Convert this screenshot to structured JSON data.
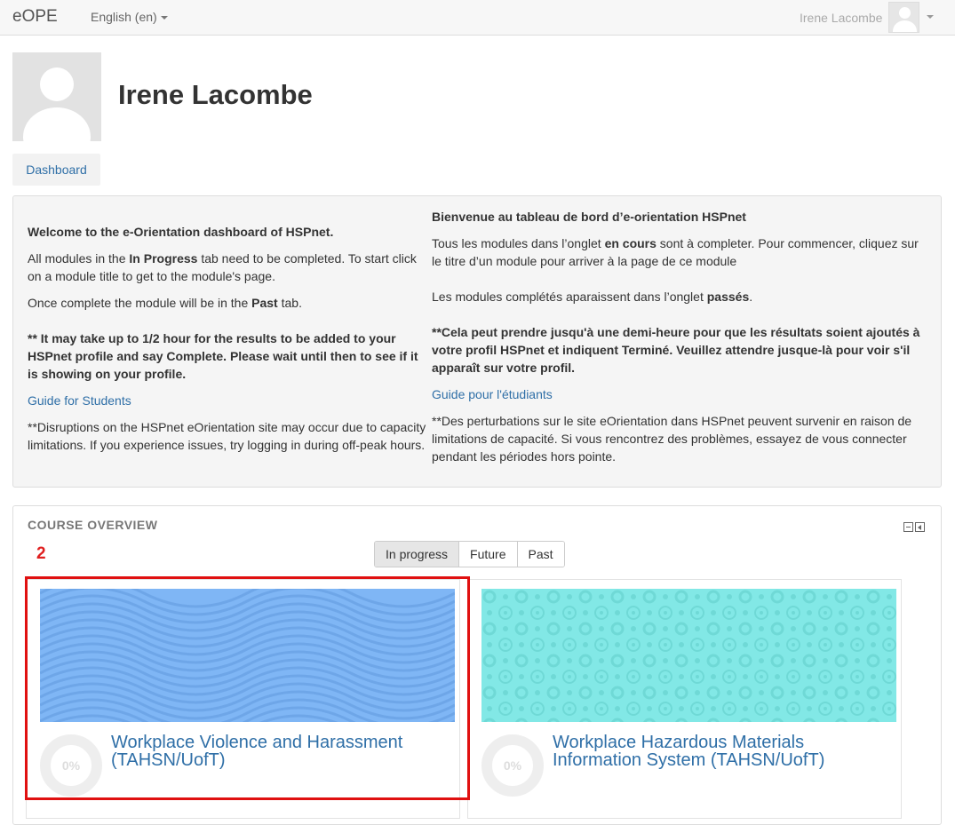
{
  "navbar": {
    "brand": "eOPE",
    "language": "English (en)",
    "user_name": "Irene Lacombe"
  },
  "profile": {
    "name": "Irene Lacombe",
    "dashboard_button": "Dashboard"
  },
  "welcome_en": {
    "heading": "Welcome to the e-Orientation dashboard of HSPnet.",
    "p1_a": "All modules in the ",
    "p1_b": "In Progress",
    "p1_c": " tab need to be completed. To start click on a module title to get to the module's page.",
    "p2_a": "Once complete the module will be in the ",
    "p2_b": "Past",
    "p2_c": " tab.",
    "note": "** It may take up to 1/2 hour for the results to be added to your HSPnet profile and say Complete. Please wait until then to see if it is showing on your profile.",
    "guide_link": "Guide for Students",
    "disruption": "**Disruptions on the HSPnet eOrientation site may occur due to capacity limitations. If you experience issues, try logging in during off-peak hours."
  },
  "welcome_fr": {
    "heading": "Bienvenue au tableau de bord d’e-orientation HSPnet",
    "p1_a": "Tous les modules dans l’onglet ",
    "p1_b": "en cours",
    "p1_c": " sont à completer. Pour commencer, cliquez sur le titre d’un module pour arriver à la page de ce module",
    "p2_a": "Les modules complétés aparaissent dans l’onglet ",
    "p2_b": "passés",
    "p2_c": ".",
    "note": "**Cela peut prendre jusqu'à une demi-heure pour que les résultats soient ajoutés à votre profil HSPnet et indiquent Terminé. Veuillez attendre jusque-là pour voir s'il apparaît sur votre profil.",
    "guide_link": "Guide pour l'étudiants",
    "disruption": "**Des perturbations sur le site eOrientation dans HSPnet peuvent survenir en raison de limitations de capacité. Si vous rencontrez des problèmes, essayez de vous connecter pendant les périodes hors pointe."
  },
  "course_overview": {
    "title": "COURSE OVERVIEW",
    "annotation": "2",
    "tabs": [
      {
        "label": "In progress",
        "active": true
      },
      {
        "label": "Future",
        "active": false
      },
      {
        "label": "Past",
        "active": false
      }
    ],
    "courses": [
      {
        "title": "Workplace Violence and Harassment (TAHSN/UofT)",
        "progress": "0%",
        "banner_color": "#7fb6f5"
      },
      {
        "title": "Workplace Hazardous Materials Information System (TAHSN/UofT)",
        "progress": "0%",
        "banner_color": "#82e8e6"
      }
    ]
  }
}
